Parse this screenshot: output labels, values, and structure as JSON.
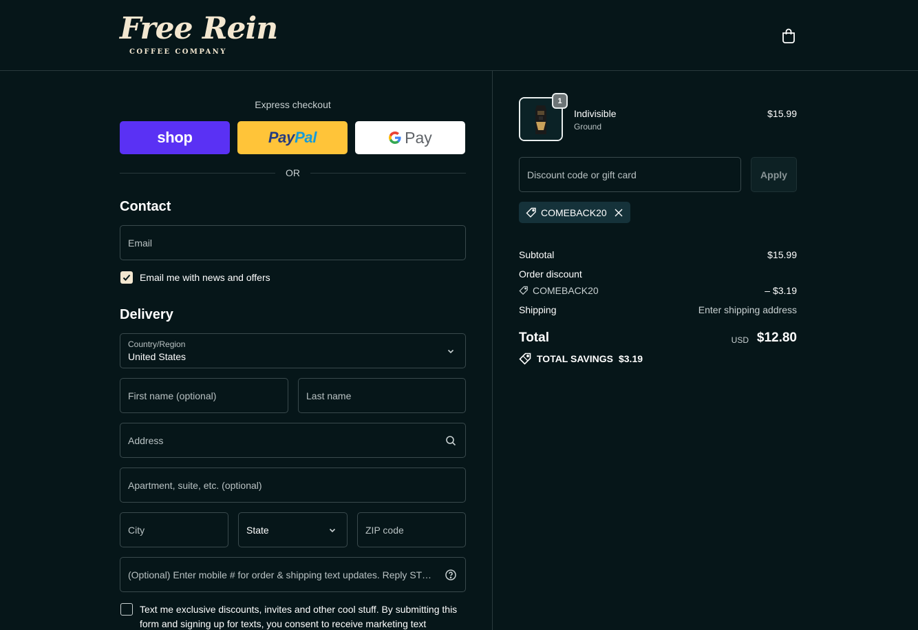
{
  "brand": {
    "logo_text": "Free Rein",
    "logo_subtext": "COFFEE COMPANY"
  },
  "header": {
    "cart_icon": "shopping-bag-icon"
  },
  "express": {
    "title": "Express checkout",
    "shop_label": "shop",
    "paypal_label_part1": "Pay",
    "paypal_label_part2": "Pal",
    "gpay_label": "Pay",
    "or_label": "OR"
  },
  "contact": {
    "title": "Contact",
    "email_placeholder": "Email",
    "newsletter_label": "Email me with news and offers",
    "newsletter_checked": true
  },
  "delivery": {
    "title": "Delivery",
    "country_label": "Country/Region",
    "country_value": "United States",
    "first_name_placeholder": "First name (optional)",
    "last_name_placeholder": "Last name",
    "address_placeholder": "Address",
    "apartment_placeholder": "Apartment, suite, etc. (optional)",
    "city_placeholder": "City",
    "state_placeholder": "State",
    "zip_placeholder": "ZIP code",
    "phone_placeholder": "(Optional) Enter mobile # for order & shipping text updates. Reply STOP to opt out.",
    "sms_label": "Text me exclusive discounts, invites and other cool stuff. By submitting this form and signing up for texts, you consent to receive marketing text",
    "sms_checked": false
  },
  "order": {
    "item": {
      "quantity": "1",
      "name": "Indivisible",
      "variant": "Ground",
      "price": "$15.99"
    },
    "discount_placeholder": "Discount code or gift card",
    "apply_label": "Apply",
    "applied_code": "COMEBACK20",
    "subtotal_label": "Subtotal",
    "subtotal_value": "$15.99",
    "order_discount_label": "Order discount",
    "order_discount_code": "COMEBACK20",
    "order_discount_value": "– $3.19",
    "shipping_label": "Shipping",
    "shipping_value": "Enter shipping address",
    "total_label": "Total",
    "total_currency": "USD",
    "total_value": "$12.80",
    "savings_label": "TOTAL SAVINGS",
    "savings_value": "$3.19"
  },
  "colors": {
    "background": "#061619",
    "accent_cream": "#f3e7d0",
    "shop_purple": "#5a31f4",
    "paypal_yellow": "#ffc439"
  }
}
